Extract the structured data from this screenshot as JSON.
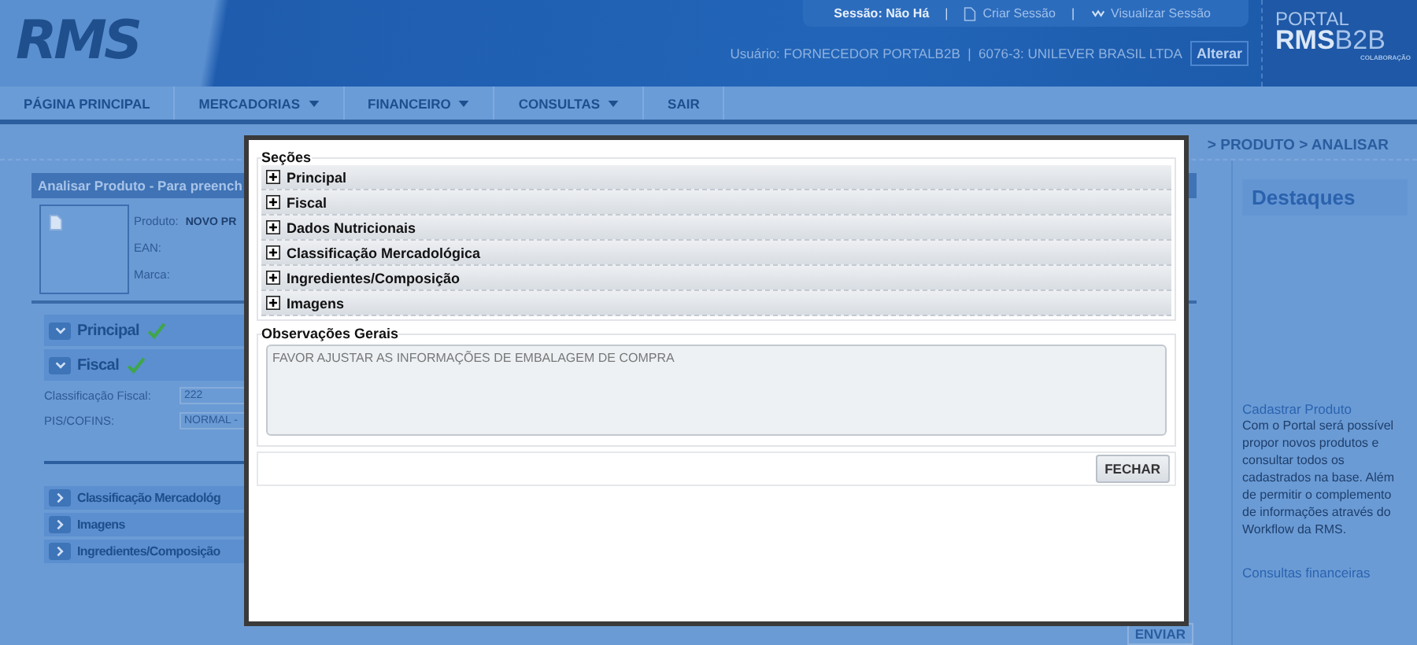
{
  "header": {
    "logo": "RMS",
    "session": {
      "status": "Sessão: Não Há",
      "separator": "|",
      "create": "Criar Sessão",
      "view": "Visualizar Sessão"
    },
    "user": "Usuário: FORNECEDOR PORTALB2B  |  6076-3: UNILEVER BRASIL LTDA",
    "change_button": "Alterar",
    "portal": {
      "top": "PORTAL",
      "brand": "RMS",
      "suffix": "B2B",
      "tagline": "COLABORAÇÃO"
    }
  },
  "nav": [
    {
      "label": "PÁGINA PRINCIPAL",
      "has_menu": false
    },
    {
      "label": "MERCADORIAS",
      "has_menu": true
    },
    {
      "label": "FINANCEIRO",
      "has_menu": true
    },
    {
      "label": "CONSULTAS",
      "has_menu": true
    },
    {
      "label": "SAIR",
      "has_menu": false
    }
  ],
  "breadcrumb": "> PRODUTO > ANALISAR",
  "panel": {
    "title": "Analisar Produto - Para preench",
    "product_label": "Produto:",
    "product_value": "NOVO PR",
    "ean_label": "EAN:",
    "brand_label": "Marca:",
    "sections_top": [
      {
        "label": "Principal",
        "expanded": true,
        "validated": true
      },
      {
        "label": "Fiscal",
        "expanded": true,
        "validated": true
      }
    ],
    "fields": [
      {
        "label": "Classificação Fiscal:",
        "value": "222"
      },
      {
        "label": "PIS/COFINS:",
        "value": "NORMAL -"
      }
    ],
    "sections_bottom": [
      {
        "label": "Classificação Mercadológ",
        "expanded": false,
        "validated": false
      },
      {
        "label": "Imagens",
        "expanded": false,
        "validated": false
      },
      {
        "label": "Ingredientes/Composição",
        "expanded": false,
        "validated": false
      }
    ],
    "submit": "ENVIAR"
  },
  "sidebar": {
    "title": "Destaques",
    "link1": "Cadastrar Produto",
    "text": "Com o Portal será possível propor novos produtos e consultar todos os cadastrados na base. Além de permitir o complemento de informações através do Workflow da RMS.",
    "link2": "Consultas financeiras"
  },
  "dialog": {
    "sections_title": "Seções",
    "sections": [
      {
        "label": "Principal",
        "expanded": false
      },
      {
        "label": "Fiscal",
        "expanded": false
      },
      {
        "label": "Dados Nutricionais",
        "expanded": false
      },
      {
        "label": "Classificação Mercadológica",
        "expanded": false
      },
      {
        "label": "Ingredientes/Composição",
        "expanded": false
      },
      {
        "label": "Imagens",
        "expanded": false
      }
    ],
    "notes_title": "Observações Gerais",
    "notes": "FAVOR AJUSTAR AS INFORMAÇÕES DE EMBALAGEM DE COMPRA",
    "close_button": "FECHAR"
  }
}
